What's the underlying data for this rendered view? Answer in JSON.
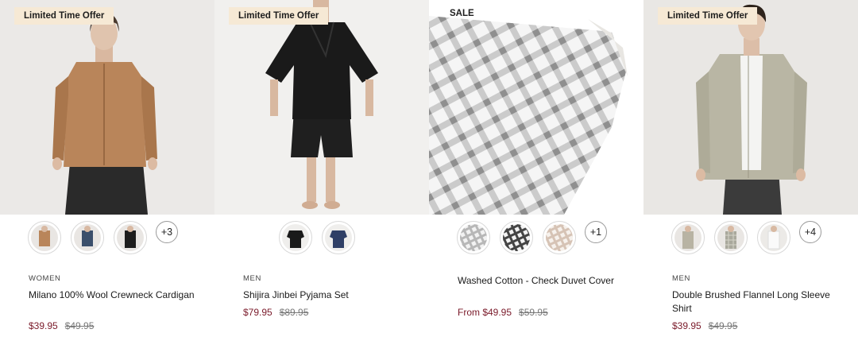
{
  "products": [
    {
      "badge": "Limited Time Offer",
      "swatches": [
        "caramel-cardigan",
        "navy-cardigan",
        "black-cardigan"
      ],
      "more": "+3",
      "category": "WOMEN",
      "name": "Milano 100% Wool Crewneck Cardigan",
      "price": "$39.95",
      "original_price": "$49.95"
    },
    {
      "badge": "Limited Time Offer",
      "swatches": [
        "black-pyjama",
        "navy-pyjama"
      ],
      "more": "",
      "category": "MEN",
      "name": "Shijira Jinbei Pyjama Set",
      "price": "$79.95",
      "original_price": "$89.95"
    },
    {
      "badge": "SALE",
      "swatches": [
        "gray-check",
        "black-check",
        "beige-check"
      ],
      "more": "+1",
      "category": "",
      "name": "Washed Cotton - Check Duvet Cover",
      "price": "From $49.95",
      "original_price": "$59.95"
    },
    {
      "badge": "Limited Time Offer",
      "swatches": [
        "beige-shirt",
        "gray-check-shirt",
        "white-shirt"
      ],
      "more": "+4",
      "category": "MEN",
      "name": "Double Brushed Flannel Long Sleeve Shirt",
      "price": "$39.95",
      "original_price": "$49.95"
    }
  ],
  "colors": {
    "badge_bg": "#f6e9d5",
    "sale_price": "#7a1a2a",
    "strike_price": "#777777"
  }
}
